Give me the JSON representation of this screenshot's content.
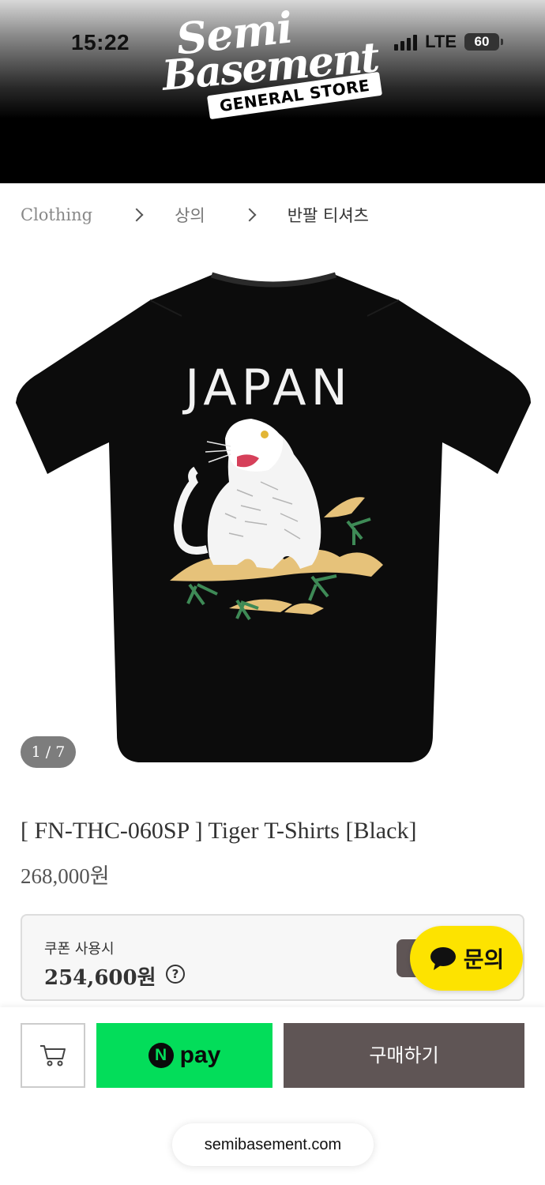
{
  "status_bar": {
    "time": "15:22",
    "network": "LTE",
    "battery": "60"
  },
  "logo": {
    "line1": "Semi",
    "line2": "Basement",
    "subtitle": "GENERAL STORE"
  },
  "breadcrumb": {
    "items": [
      "Clothing",
      "상의",
      "반팔 티셔츠"
    ]
  },
  "product": {
    "image_text": "JAPAN",
    "image_counter": "1 / 7",
    "name": "[ FN-THC-060SP ] Tiger T-Shirts [Black]",
    "price": "268,000원"
  },
  "coupon": {
    "label": "쿠폰 사용시",
    "price": "254,600원",
    "help": "?"
  },
  "chat": {
    "label": "문의"
  },
  "actions": {
    "npay_n": "N",
    "npay_label": "pay",
    "buy_label": "구매하기"
  },
  "browser": {
    "url": "semibasement.com"
  },
  "colors": {
    "buy_button": "#5f5555",
    "npay": "#03dd5a",
    "chat": "#fde300"
  }
}
